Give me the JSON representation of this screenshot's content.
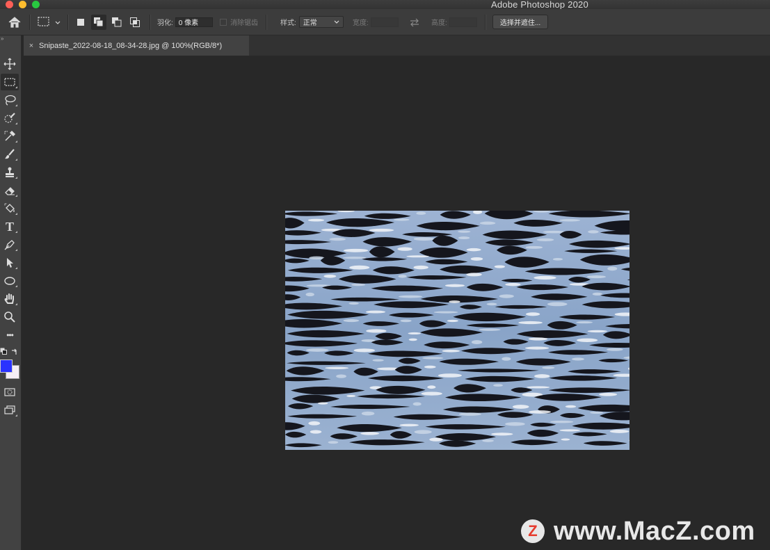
{
  "app": {
    "title": "Adobe Photoshop 2020"
  },
  "options_bar": {
    "feather_label": "羽化:",
    "feather_value": "0 像素",
    "antialias_label": "消除锯齿",
    "style_label": "样式:",
    "style_value": "正常",
    "width_label": "宽度:",
    "height_label": "高度:",
    "select_mask_button": "选择并遮住..."
  },
  "document_tab": {
    "close": "×",
    "title": "Snipaste_2022-08-18_08-34-28.jpg @ 100%(RGB/8*)"
  },
  "toolbar": {
    "tools": [
      "move-icon",
      "rect-marquee-icon",
      "lasso-icon",
      "quick-select-icon",
      "eyedropper-icon",
      "brush-icon",
      "stamp-icon",
      "eraser-icon",
      "paint-bucket-icon",
      "type-icon",
      "pen-icon",
      "path-select-icon",
      "ellipse-icon",
      "hand-icon",
      "zoom-icon",
      "more-icon"
    ],
    "type_glyph": "T",
    "more_glyph": "•••",
    "foreground_color": "#2a32ff",
    "background_color": "#f5eef5"
  },
  "watermark": {
    "logo_letter": "Z",
    "text": "www.MacZ.com"
  }
}
